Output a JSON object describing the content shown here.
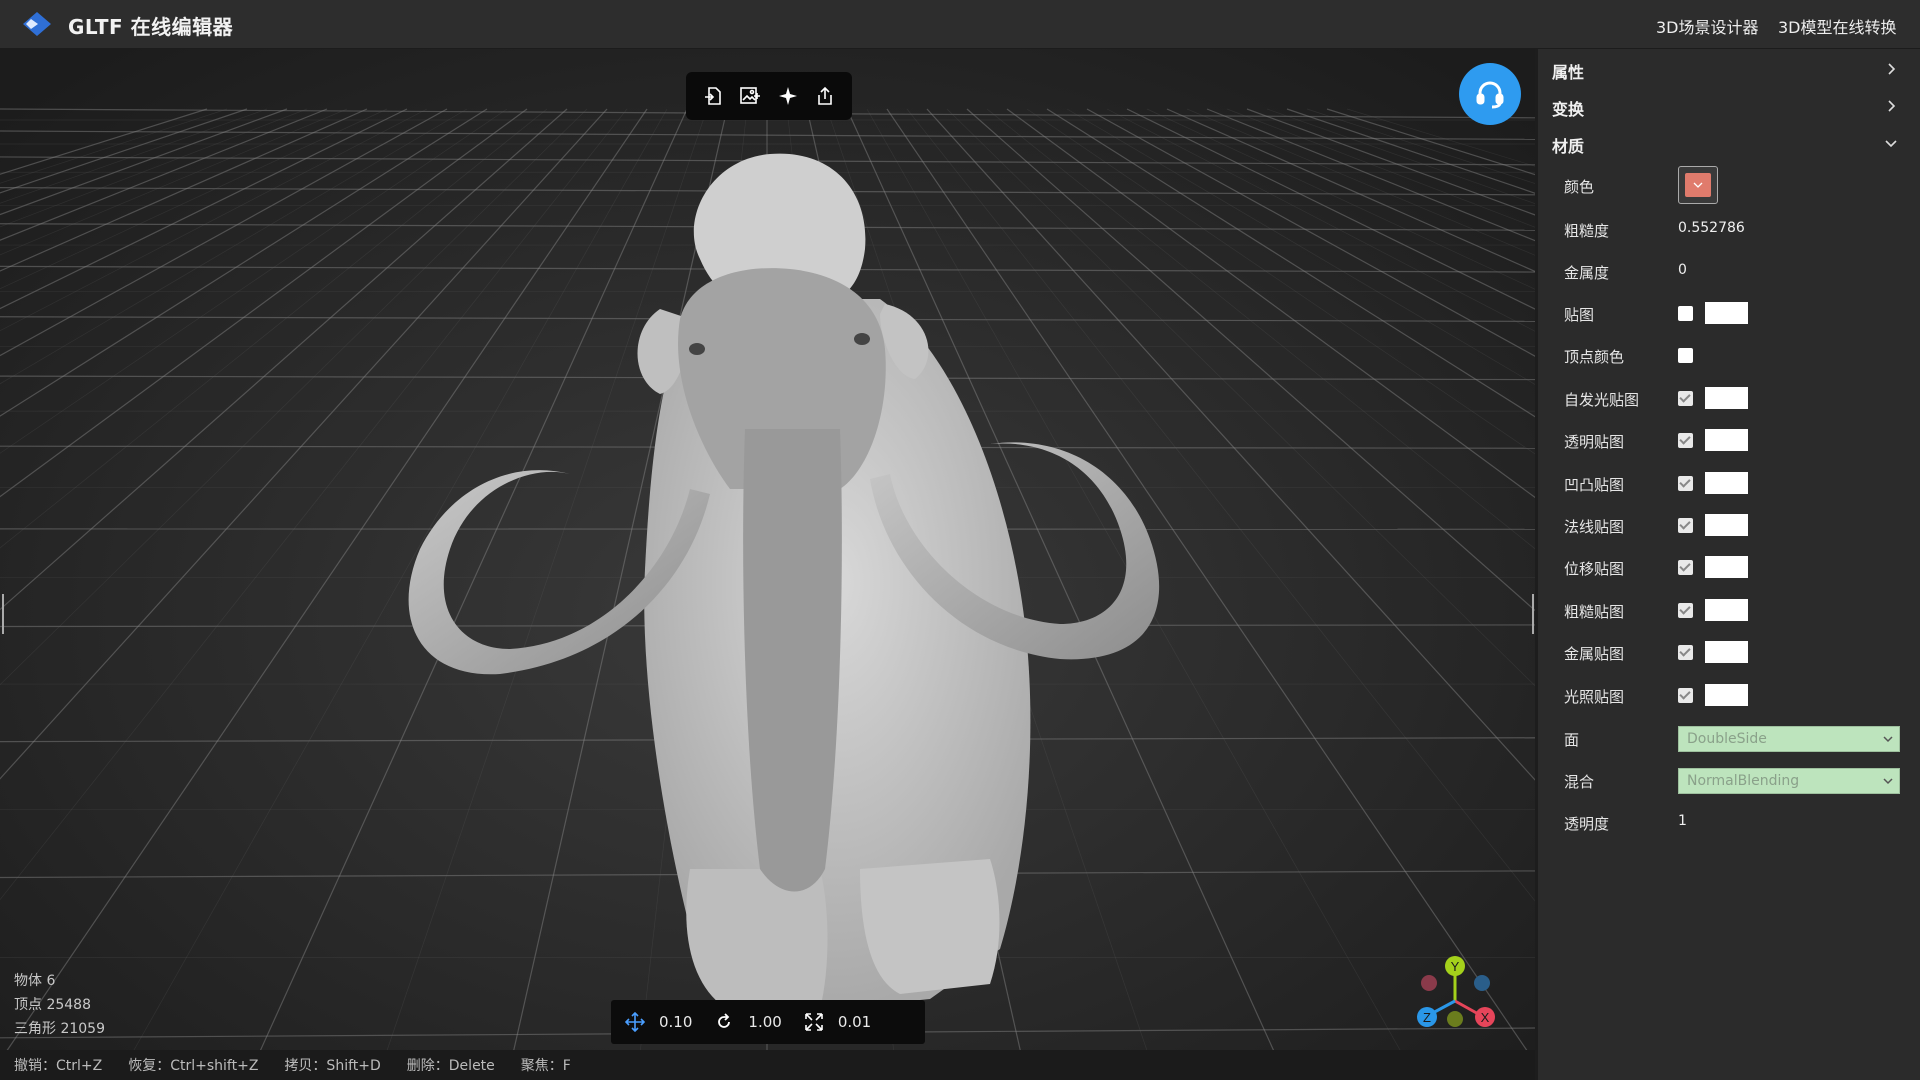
{
  "header": {
    "title": "GLTF 在线编辑器",
    "links": [
      "3D场景设计器",
      "3D模型在线转换"
    ]
  },
  "toolbar": {
    "icons": [
      "import-icon",
      "import-image-icon",
      "light-icon",
      "export-icon"
    ]
  },
  "stats": {
    "objects": "物体 6",
    "vertices": "顶点 25488",
    "triangles": "三角形 21059"
  },
  "transform": {
    "translate": "0.10",
    "rotate": "1.00",
    "scale": "0.01"
  },
  "shortcuts": [
    "撤销：Ctrl+Z",
    "恢复：Ctrl+shift+Z",
    "拷贝：Shift+D",
    "删除：Delete",
    "聚焦：F"
  ],
  "gizmo": {
    "x": "X",
    "y": "Y",
    "z": "Z"
  },
  "panel": {
    "sections": {
      "properties": "属性",
      "transform": "变换",
      "material": "材质"
    },
    "material": {
      "color_label": "颜色",
      "color_value": "#e07b6c",
      "roughness_label": "粗糙度",
      "roughness_value": "0.552786",
      "metalness_label": "金属度",
      "metalness_value": "0",
      "maps": [
        {
          "label": "贴图",
          "checked": false,
          "swatch": true
        },
        {
          "label": "顶点颜色",
          "checked": false,
          "swatch": false
        },
        {
          "label": "自发光贴图",
          "checked": true,
          "swatch": true
        },
        {
          "label": "透明贴图",
          "checked": true,
          "swatch": true
        },
        {
          "label": "凹凸贴图",
          "checked": true,
          "swatch": true
        },
        {
          "label": "法线贴图",
          "checked": true,
          "swatch": true
        },
        {
          "label": "位移贴图",
          "checked": true,
          "swatch": true
        },
        {
          "label": "粗糙贴图",
          "checked": true,
          "swatch": true
        },
        {
          "label": "金属贴图",
          "checked": true,
          "swatch": true
        },
        {
          "label": "光照贴图",
          "checked": true,
          "swatch": true
        }
      ],
      "side_label": "面",
      "side_value": "DoubleSide",
      "blending_label": "混合",
      "blending_value": "NormalBlending",
      "opacity_label": "透明度",
      "opacity_value": "1"
    }
  }
}
